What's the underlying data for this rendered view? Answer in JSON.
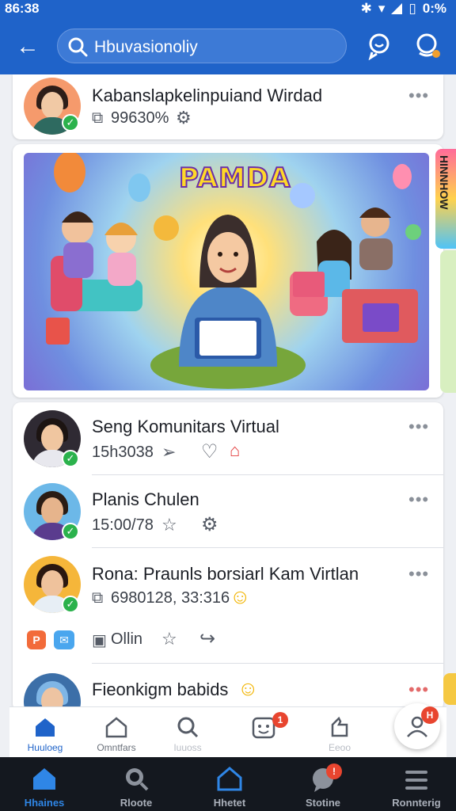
{
  "status_bar": {
    "time": "86:38",
    "battery": "0:%"
  },
  "search": {
    "placeholder": "Hbuvasionoliy"
  },
  "feed": {
    "top_card": {
      "title": "Kabanslapkelinpuiand Wirdad",
      "meta": "99630%"
    },
    "banner": {
      "title": "PAMDA",
      "side_tab": "HINNHOW"
    },
    "posts": [
      {
        "title": "Seng Komunitars Virtual",
        "meta": "15h3038"
      },
      {
        "title": "Planis Chulen",
        "meta": "15:00/78"
      },
      {
        "title": "Rona: Praunls borsiarl Kam Virtlan",
        "meta": "6980128, 33:316",
        "actions_label": "Ollin"
      },
      {
        "title": "Fieonkigm babids"
      }
    ]
  },
  "bottom_tabs": [
    {
      "label": "Huuloeg"
    },
    {
      "label": "Omntfars"
    },
    {
      "label": "Iuuoss"
    },
    {
      "label": "",
      "badge": "1"
    },
    {
      "label": "Eeoo"
    }
  ],
  "fab_badge": "H",
  "nav_bar": [
    {
      "label": "Hhaines"
    },
    {
      "label": "Rloote"
    },
    {
      "label": "Hhetet"
    },
    {
      "label": "Stotine",
      "badge": "!"
    },
    {
      "label": "Ronnterig"
    }
  ],
  "colors": {
    "primary": "#1f63c9",
    "success": "#2bb24c",
    "alert": "#e8452f",
    "nav_dark": "#14181f"
  }
}
